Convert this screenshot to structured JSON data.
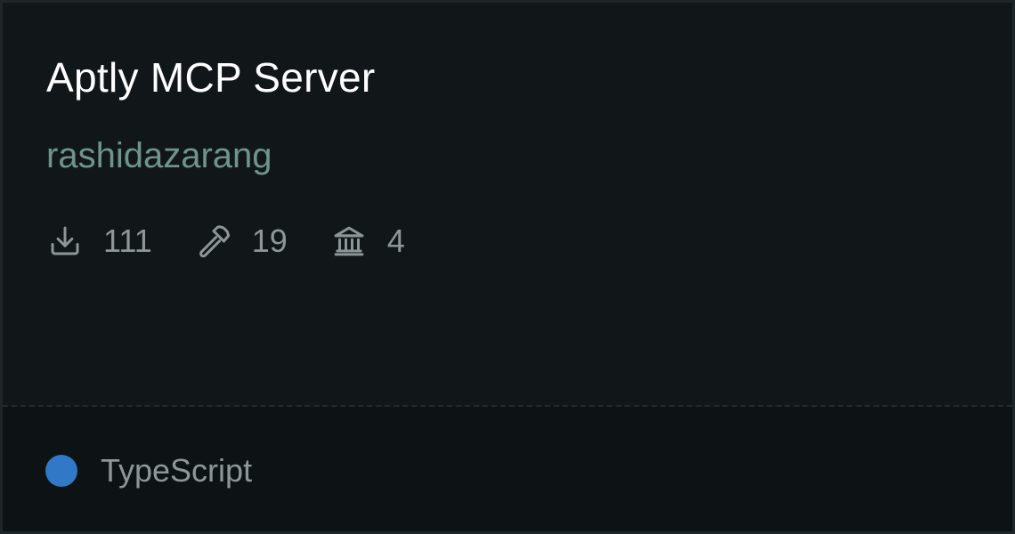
{
  "card": {
    "title": "Aptly MCP Server",
    "author": "rashidazarang",
    "stats": {
      "downloads": {
        "icon": "download-icon",
        "value": "111"
      },
      "tools": {
        "icon": "hammer-icon",
        "value": "19"
      },
      "resources": {
        "icon": "bank-icon",
        "value": "4"
      }
    },
    "language": {
      "name": "TypeScript",
      "color": "#3178c6"
    }
  }
}
